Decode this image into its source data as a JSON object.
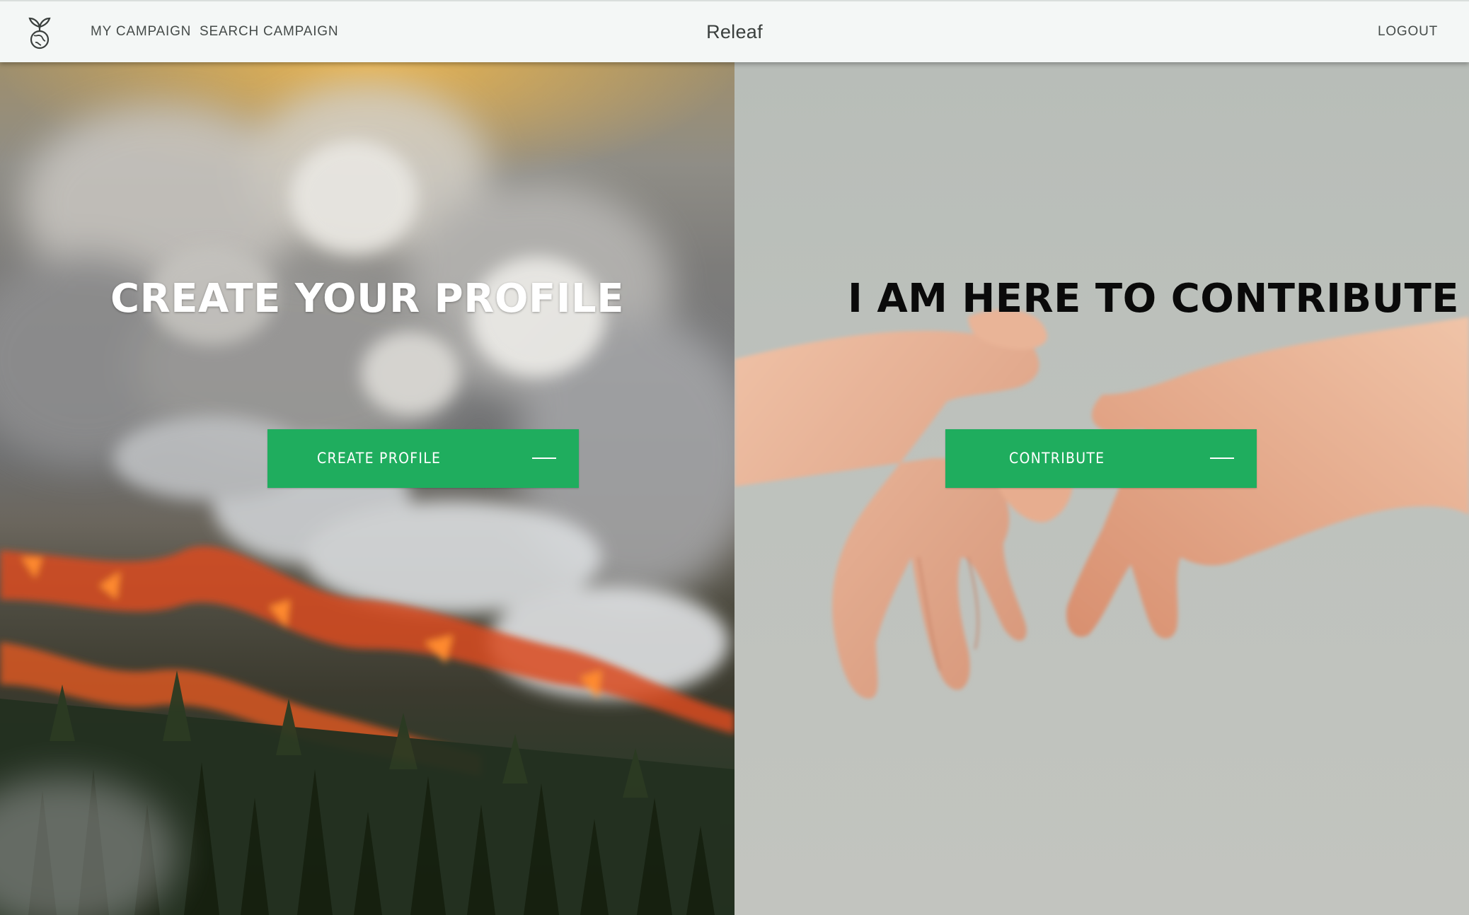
{
  "header": {
    "nav_my_campaign": "MY CAMPAIGN",
    "nav_search_campaign": "SEARCH CAMPAIGN",
    "brand": "Releaf",
    "logout": "LOGOUT",
    "logo_icon": "sprout-globe-icon"
  },
  "left_panel": {
    "headline": "CREATE YOUR PROFILE",
    "button_label": "CREATE PROFILE",
    "button_icon": "dash-icon",
    "background": "forest-fire-photo"
  },
  "right_panel": {
    "headline": "I AM HERE TO CONTRIBUTE",
    "button_label": "CONTRIBUTE",
    "button_icon": "dash-icon",
    "background": "holding-hands-photo"
  },
  "colors": {
    "button": "#1fad5e",
    "topbar": "#f4f7f6",
    "right_background": "#bcc0bb"
  }
}
